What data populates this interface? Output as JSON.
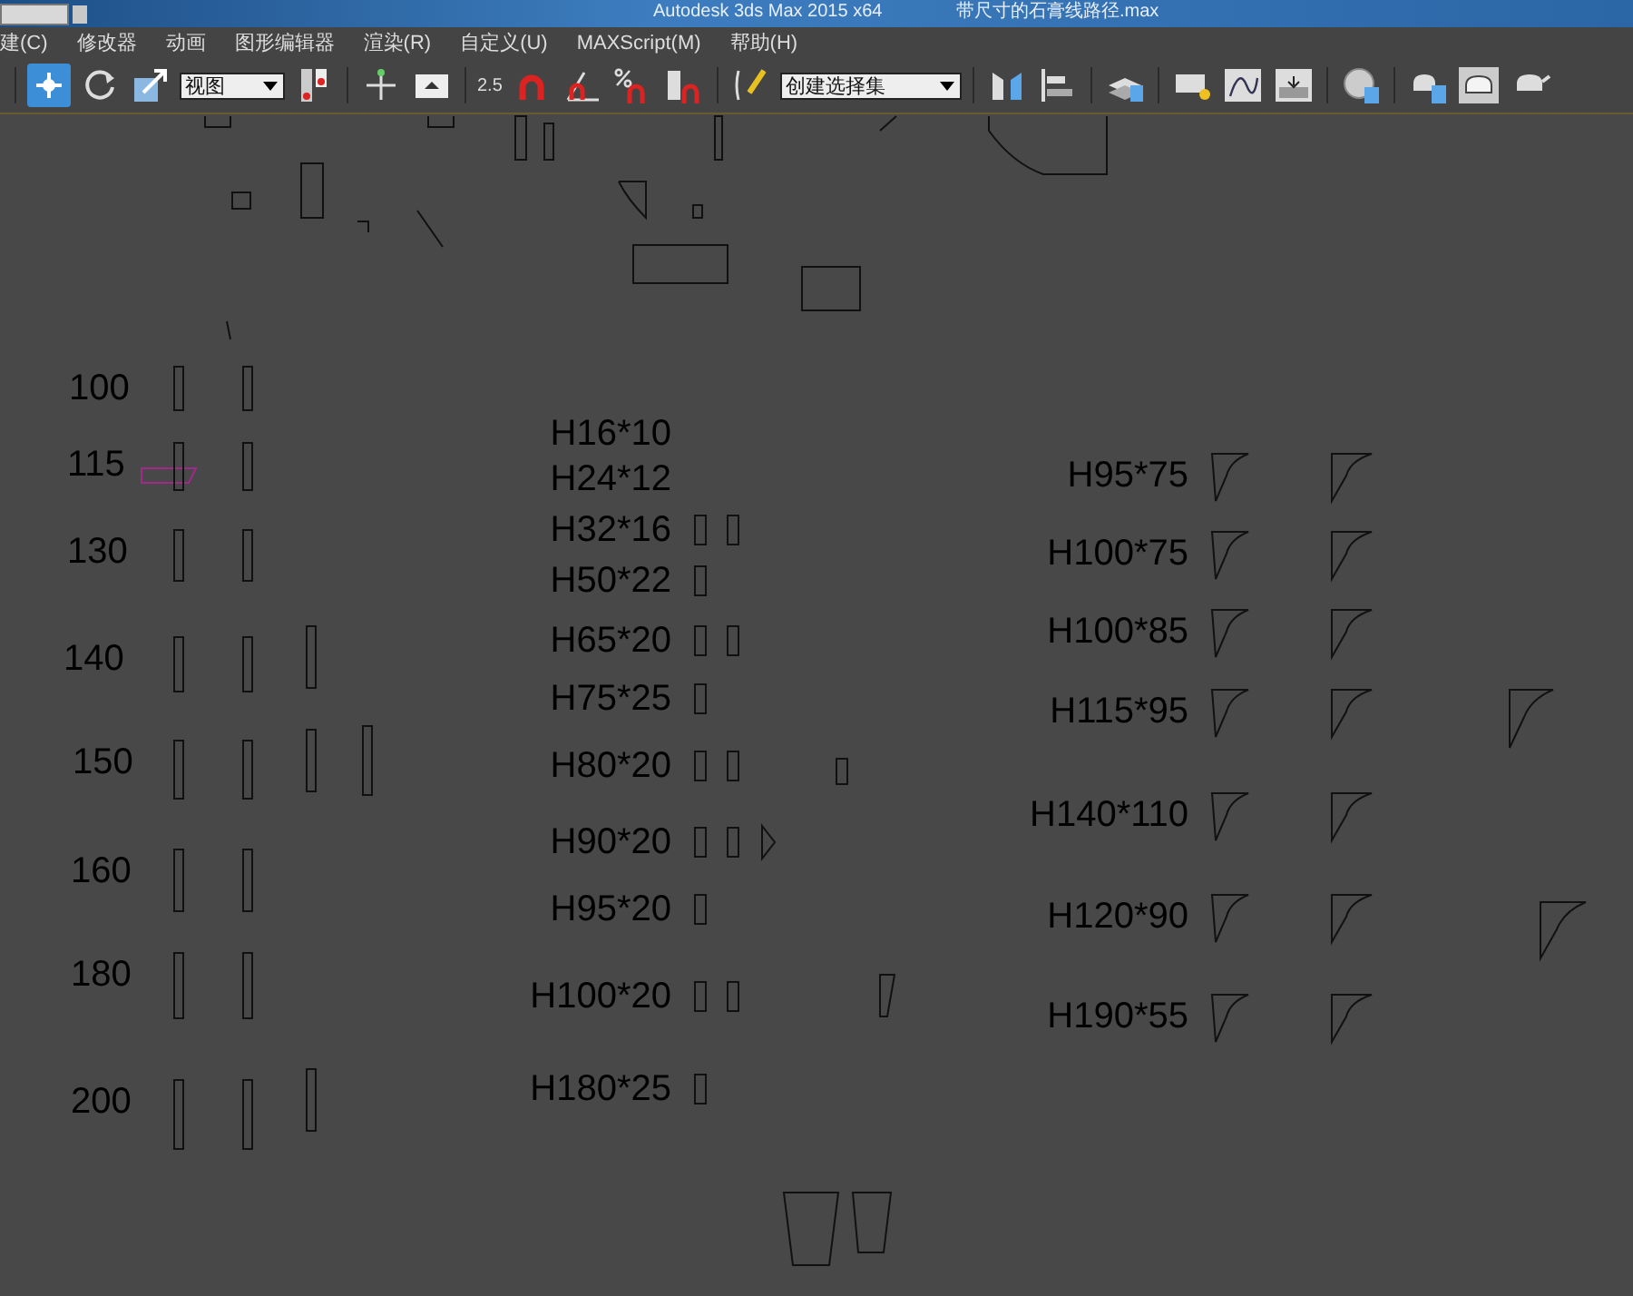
{
  "title_bar": {
    "app_title": "Autodesk 3ds Max  2015 x64",
    "file_name": "带尺寸的石膏线路径.max"
  },
  "menu": [
    "建(C)",
    "修改器",
    "动画",
    "图形编辑器",
    "渲染(R)",
    "自定义(U)",
    "MAXScript(M)",
    "帮助(H)"
  ],
  "toolbar": {
    "transform_tools": [
      {
        "kind": "move",
        "selected": true
      },
      {
        "kind": "rotate",
        "selected": false
      },
      {
        "kind": "scale",
        "selected": false
      }
    ],
    "reference_dropdown": "视图",
    "snap_value": "2.5",
    "selection_set": "创建选择集"
  },
  "viewport": {
    "widths": [
      "100",
      "115",
      "130",
      "140",
      "150",
      "160",
      "180",
      "200"
    ],
    "small_profiles": [
      "H16*10",
      "H24*12",
      "H32*16",
      "H50*22",
      "H65*20",
      "H75*25",
      "H80*20",
      "H90*20",
      "H95*20",
      "H100*20",
      "H180*25"
    ],
    "crown_profiles": [
      "H95*75",
      "H100*75",
      "H100*85",
      "H115*95",
      "H140*110",
      "H120*90",
      "H190*55"
    ]
  }
}
